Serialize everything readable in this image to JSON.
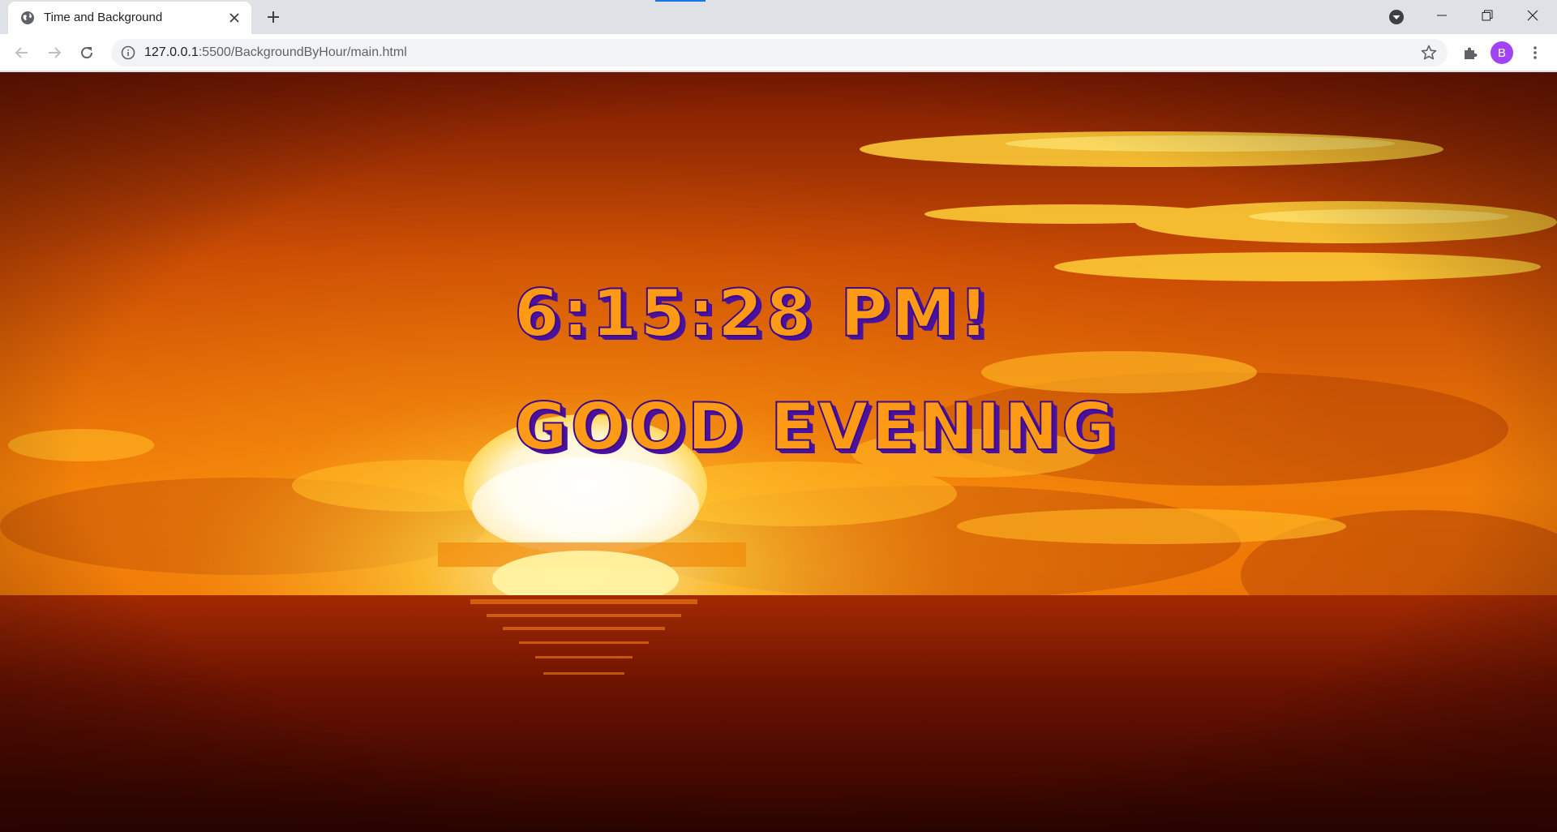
{
  "browser": {
    "tab_title": "Time and Background",
    "url_host": "127.0.0.1",
    "url_rest": ":5500/BackgroundByHour/main.html",
    "profile_initial": "B",
    "accent_color": "#1a73e8",
    "avatar_color": "#a142f4"
  },
  "icons": {
    "favicon": "globe-icon",
    "tab_close": "close-icon",
    "new_tab": "plus-icon",
    "tab_search": "chevron-down-circle-icon",
    "back": "arrow-left-icon",
    "forward": "arrow-right-icon",
    "reload": "reload-icon",
    "site_info": "info-icon",
    "bookmark": "star-icon",
    "extensions": "puzzle-icon",
    "menu": "kebab-menu-icon"
  },
  "page": {
    "clock_text": "6:15:28 PM!",
    "greeting_text": "GOOD EVENING",
    "text_fill_color": "#ff9a16",
    "text_outline_color": "#3c0a8a",
    "background_scene": "sunset over ocean"
  }
}
